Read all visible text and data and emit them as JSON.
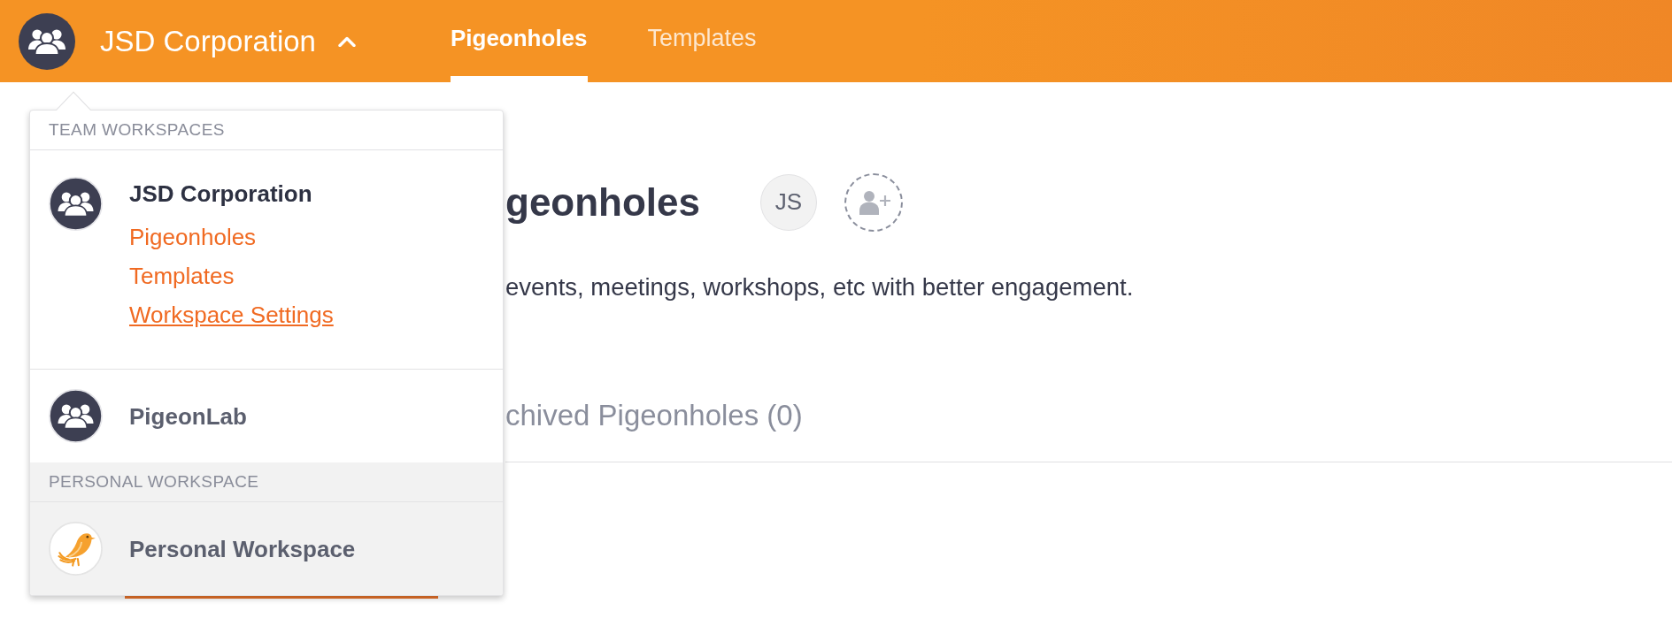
{
  "topbar": {
    "workspace_name": "JSD Corporation",
    "menu_expanded": true,
    "tabs": [
      {
        "label": "Pigeonholes",
        "selected": true
      },
      {
        "label": "Templates",
        "selected": false
      }
    ]
  },
  "workspace_menu": {
    "sections": [
      {
        "heading": "TEAM WORKSPACES",
        "kind": "team",
        "workspaces": [
          {
            "name": "JSD Corporation",
            "selected": true,
            "links": [
              {
                "label": "Pigeonholes",
                "hovered": false
              },
              {
                "label": "Templates",
                "hovered": false
              },
              {
                "label": "Workspace Settings",
                "hovered": true
              }
            ]
          },
          {
            "name": "PigeonLab",
            "selected": false
          }
        ]
      },
      {
        "heading": "PERSONAL WORKSPACE",
        "kind": "personal",
        "workspaces": [
          {
            "name": "Personal Workspace",
            "selected": false
          }
        ]
      }
    ]
  },
  "page": {
    "title": "geonholes",
    "members": [
      {
        "initials": "JS"
      }
    ],
    "description": "events, meetings, workshops, etc with better engagement.",
    "tabs": [
      {
        "label": "chived Pigeonholes (0)",
        "selected": false
      }
    ]
  }
}
